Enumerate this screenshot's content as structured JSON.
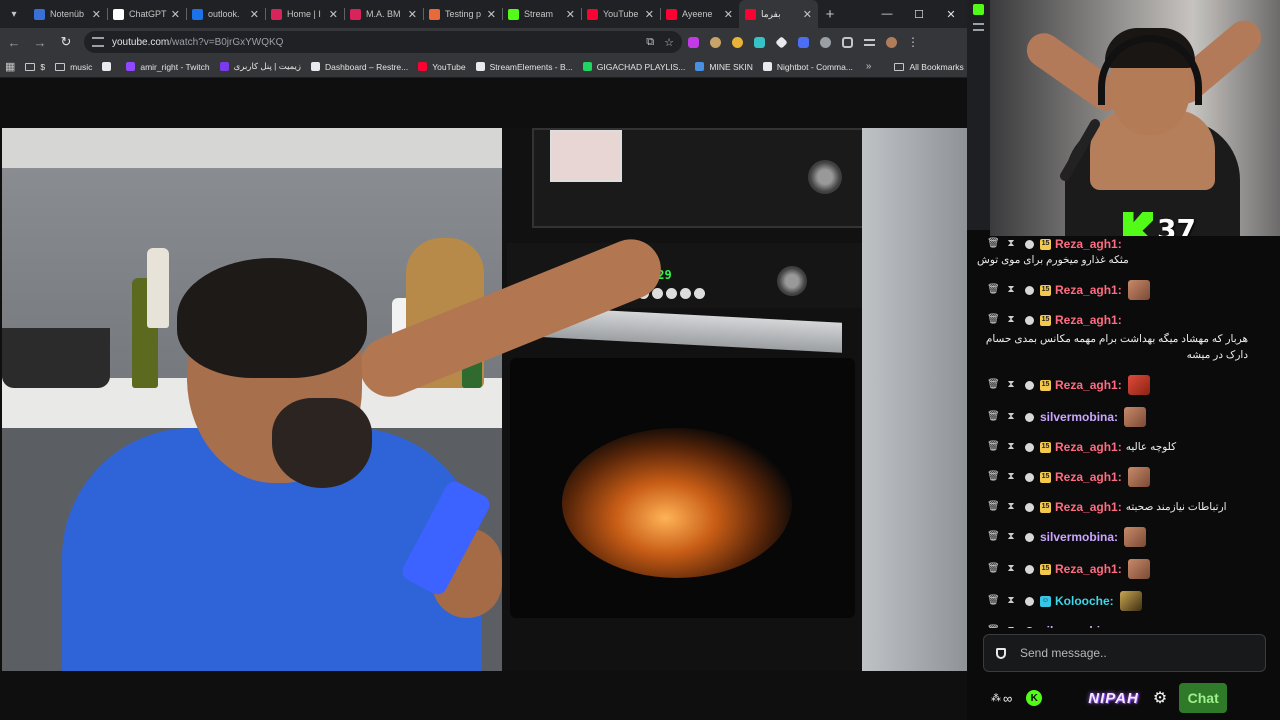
{
  "browser": {
    "tabs": [
      {
        "title": "Notenüb",
        "fav": "#3b6fd8",
        "active": false
      },
      {
        "title": "ChatGPT",
        "fav": "#ffffff",
        "active": false
      },
      {
        "title": "outlook.",
        "fav": "#1a73e8",
        "active": false
      },
      {
        "title": "Home | I",
        "fav": "#d8235b",
        "active": false
      },
      {
        "title": "M.A. BM",
        "fav": "#d8235b",
        "active": false
      },
      {
        "title": "Testing p",
        "fav": "#e86a3a",
        "active": false
      },
      {
        "title": "Stream",
        "fav": "#53fc18",
        "active": false
      },
      {
        "title": "YouTube",
        "fav": "#ff0033",
        "active": false
      },
      {
        "title": "Ayeene",
        "fav": "#ff0033",
        "active": false
      },
      {
        "title": "بفرما",
        "fav": "#ff0033",
        "active": true
      }
    ],
    "new_tab": "+",
    "window": {
      "minimize": "—",
      "maximize": "☐",
      "close": "✕"
    },
    "url_domain": "youtube.com",
    "url_path": "/watch?v=B0jrGxYWQKQ",
    "bookmarks": [
      {
        "label": "$",
        "type": "folder",
        "fav": ""
      },
      {
        "label": "music",
        "type": "folder",
        "fav": ""
      },
      {
        "label": "",
        "type": "site",
        "fav": "#e8eaed"
      },
      {
        "label": "amir_right - Twitch",
        "type": "site",
        "fav": "#9146ff"
      },
      {
        "label": "زیمیت | پنل کاربری",
        "type": "site",
        "fav": "#7c3aed"
      },
      {
        "label": "Dashboard – Restre...",
        "type": "site",
        "fav": "#e8eaed"
      },
      {
        "label": "YouTube",
        "type": "site",
        "fav": "#ff0033"
      },
      {
        "label": "StreamElements - B...",
        "type": "site",
        "fav": "#e8eaed"
      },
      {
        "label": "GIGACHAD PLAYLIS...",
        "type": "site",
        "fav": "#1ed760"
      },
      {
        "label": "MINE SKIN",
        "type": "site",
        "fav": "#4a90e2"
      },
      {
        "label": "Nightbot - Comma...",
        "type": "site",
        "fav": "#e8eaed"
      }
    ],
    "bookmarks_more": "»",
    "all_bookmarks": "All Bookmarks"
  },
  "video": {
    "oven_display": "129"
  },
  "stream": {
    "viewer_count": "37"
  },
  "chat": {
    "messages": [
      {
        "user": "Reza_agh1:",
        "color": "#ff6b81",
        "badge": "sub",
        "text": "مثکه غذارو میخورم برای موی توش",
        "emote": ""
      },
      {
        "user": "Reza_agh1:",
        "color": "#ff6b81",
        "badge": "sub",
        "text": "",
        "emote": "face"
      },
      {
        "user": "Reza_agh1:",
        "color": "#ff6b81",
        "badge": "sub",
        "text": "هربار که مهشاد میگه بهداشت برام مهمه مکانس بمدی حسام دارک در میشه",
        "emote": ""
      },
      {
        "user": "Reza_agh1:",
        "color": "#ff6b81",
        "badge": "sub",
        "text": "",
        "emote": "red"
      },
      {
        "user": "silvermobina:",
        "color": "#c9a7ff",
        "badge": "",
        "text": "",
        "emote": "face"
      },
      {
        "user": "Reza_agh1:",
        "color": "#ff6b81",
        "badge": "sub",
        "text": "کلوچه عالیه",
        "emote": ""
      },
      {
        "user": "Reza_agh1:",
        "color": "#ff6b81",
        "badge": "sub",
        "text": "",
        "emote": "face"
      },
      {
        "user": "Reza_agh1:",
        "color": "#ff6b81",
        "badge": "sub",
        "text": "ارتباطات نیازمند صحبته",
        "emote": ""
      },
      {
        "user": "silvermobina:",
        "color": "#c9a7ff",
        "badge": "",
        "text": "",
        "emote": "face"
      },
      {
        "user": "Reza_agh1:",
        "color": "#ff6b81",
        "badge": "sub",
        "text": "",
        "emote": "face"
      },
      {
        "user": "Kolooche:",
        "color": "#3ed6e8",
        "badge": "gift",
        "text": "",
        "emote": "dark"
      },
      {
        "user": "silvermobina:",
        "color": "#c9a7ff",
        "badge": "",
        "text": "وای من این سری رو ندیده بودم انقدر خندیدم لوپام درد میکنه",
        "emote": "face"
      }
    ],
    "placeholder": "Send message..",
    "footer": {
      "infinite": "∞",
      "k_label": "K",
      "brand": "NIPAH",
      "gear": "⚙",
      "chat_button": "Chat"
    }
  }
}
